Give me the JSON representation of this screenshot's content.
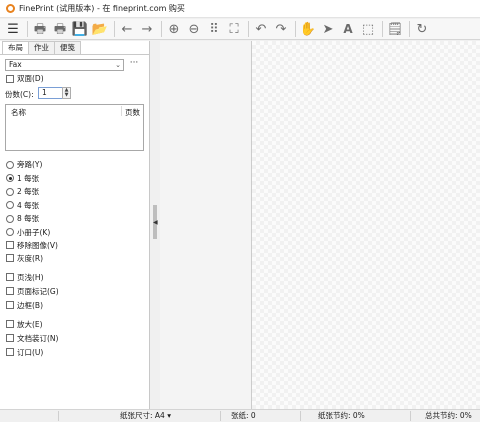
{
  "window": {
    "title": "FinePrint (试用版本) - 在 fineprint.com 购买"
  },
  "toolbar": {
    "icons": [
      "menu-icon",
      "printer-icon",
      "print-doc-icon",
      "save-icon",
      "open-folder-icon",
      "back-arrow-icon",
      "forward-arrow-icon",
      "zoom-in-icon",
      "zoom-out-icon",
      "grid-icon",
      "fit-page-icon",
      "undo-icon",
      "redo-icon",
      "hand-icon",
      "pointer-icon",
      "text-icon",
      "select-rect-icon",
      "notes-icon",
      "refresh-icon"
    ],
    "glyphs": {
      "menu": "☰",
      "printer": "🖶",
      "print_doc": "🖶",
      "save": "💾",
      "folder": "📂",
      "back": "←",
      "forward": "→",
      "zoom_in": "⊕",
      "zoom_out": "⊖",
      "grid": "⠿",
      "fit": "⛶",
      "undo": "↶",
      "redo": "↷",
      "hand": "✋",
      "pointer": "➤",
      "text": "A",
      "select": "⬚",
      "notes": "🗒",
      "refresh": "↻"
    }
  },
  "tabs": [
    "布局",
    "作业",
    "便笺"
  ],
  "printer": {
    "selected": "Fax",
    "arrow": "⌄",
    "more": "···"
  },
  "options": {
    "duplex": "双面(D)",
    "copies_label": "份数(C):",
    "copies_value": "1",
    "spinner": {
      "up": "▲",
      "down": "▼"
    }
  },
  "job_list": {
    "col_name": "名称",
    "col_pages": "页数"
  },
  "layout": {
    "items": [
      "旁路(Y)",
      "1 每张",
      "2 每张",
      "4 每张",
      "8 每张",
      "小册子(K)"
    ],
    "selected_index": 1
  },
  "checks_a": [
    "移除图像(V)",
    "灰度(R)"
  ],
  "checks_b": [
    "页浅(H)",
    "页面标记(G)",
    "边框(B)"
  ],
  "checks_c": [
    "放大(E)",
    "文档装订(N)",
    "订口(U)"
  ],
  "statusbar": {
    "paper_size": "纸张尺寸: A4",
    "paper_size_arrow": "▾",
    "sheets": "张纸:  0",
    "paper_saved": "纸张节约:  0%",
    "total_saved": "总共节约:  0%"
  }
}
